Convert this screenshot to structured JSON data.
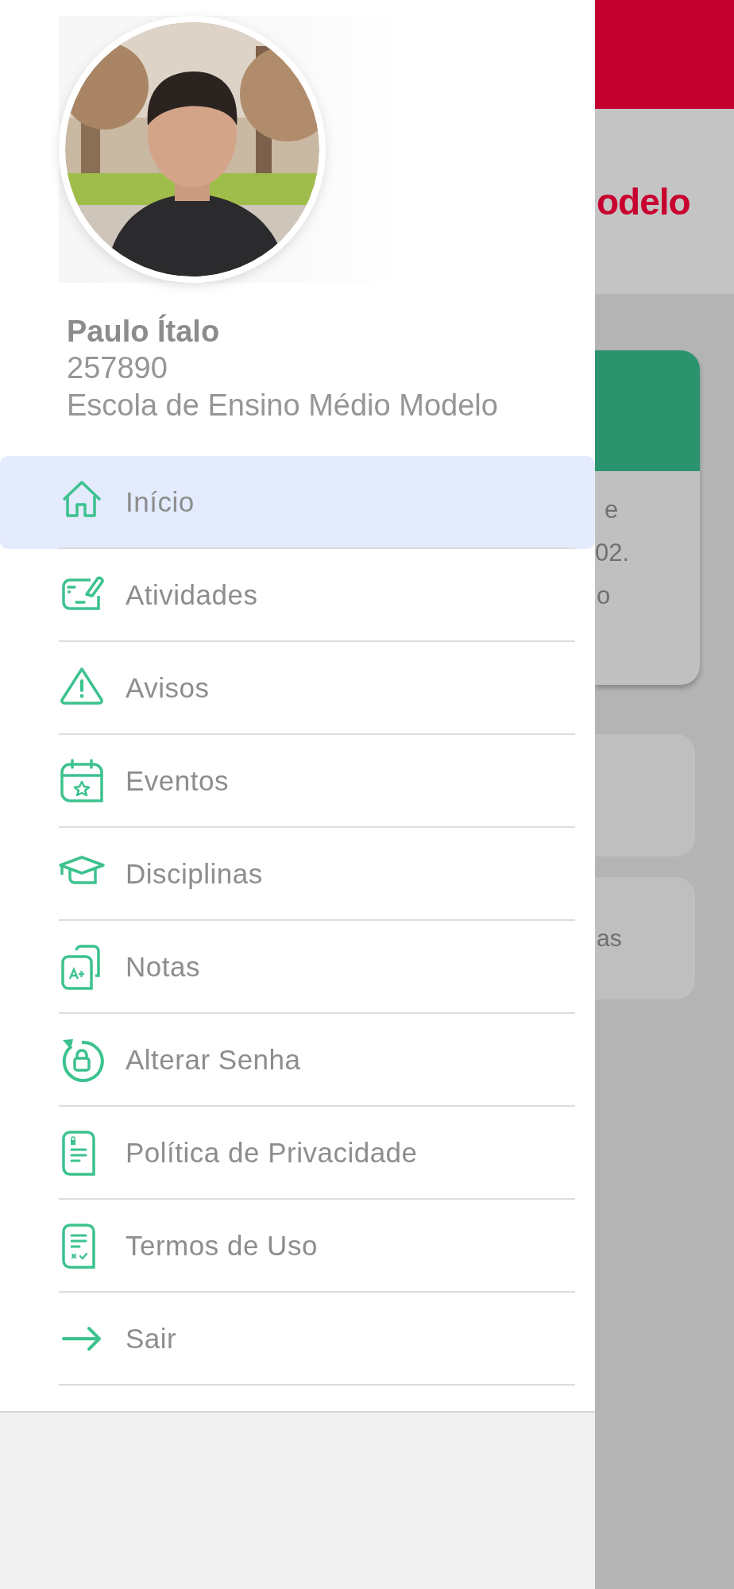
{
  "profile": {
    "name": "Paulo Ítalo",
    "registration": "257890",
    "school": "Escola de Ensino Médio Modelo"
  },
  "menu": [
    {
      "label": "Início",
      "kind": "home",
      "selected": true
    },
    {
      "label": "Atividades",
      "kind": "activity",
      "selected": false
    },
    {
      "label": "Avisos",
      "kind": "warning",
      "selected": false
    },
    {
      "label": "Eventos",
      "kind": "calendar",
      "selected": false
    },
    {
      "label": "Disciplinas",
      "kind": "cap",
      "selected": false
    },
    {
      "label": "Notas",
      "kind": "grade",
      "selected": false
    },
    {
      "label": "Alterar Senha",
      "kind": "lock",
      "selected": false
    },
    {
      "label": "Política de Privacidade",
      "kind": "privacy",
      "selected": false
    },
    {
      "label": "Termos de Uso",
      "kind": "terms",
      "selected": false
    },
    {
      "label": "Sair",
      "kind": "logout",
      "selected": false
    }
  ],
  "background": {
    "logo_text": "odelo",
    "card_lines": [
      "e",
      "02.",
      "o"
    ],
    "tile_text": "as"
  }
}
